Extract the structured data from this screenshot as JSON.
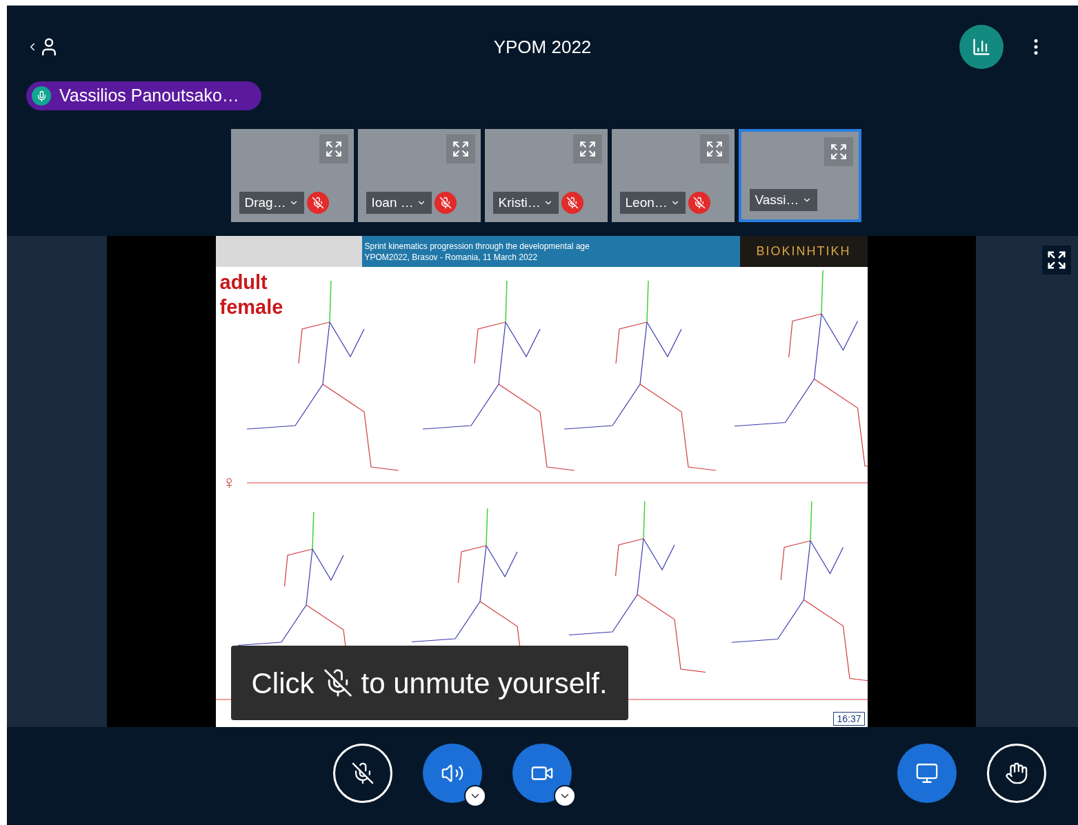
{
  "header": {
    "title": "YPOM 2022"
  },
  "talking_indicator": {
    "name": "Vassilios Panoutsako…"
  },
  "webcams": [
    {
      "name": "Drag…",
      "muted": true,
      "selected": false
    },
    {
      "name": "Ioan …",
      "muted": true,
      "selected": false
    },
    {
      "name": "Kristi…",
      "muted": true,
      "selected": false
    },
    {
      "name": "Leon…",
      "muted": true,
      "selected": false
    },
    {
      "name": "Vassi…",
      "muted": false,
      "selected": true
    }
  ],
  "slide": {
    "banner_lines": [
      "Sprint kinematics progression through the developmental age",
      "YPOM2022, Brasov - Romania, 11 March 2022"
    ],
    "logo_text": "BIOKINHTIKH",
    "label_lines": [
      "adult",
      "female"
    ],
    "symbol": "♀",
    "timestamp": "16:37"
  },
  "tooltip": {
    "before": "Click",
    "after": "to unmute yourself."
  },
  "controls": [
    {
      "kind": "mic",
      "on": false,
      "menu": false
    },
    {
      "kind": "audio",
      "on": true,
      "menu": true
    },
    {
      "kind": "camera",
      "on": true,
      "menu": true
    },
    {
      "kind": "screen",
      "on": true,
      "menu": false
    },
    {
      "kind": "hand",
      "on": false,
      "menu": false
    }
  ]
}
